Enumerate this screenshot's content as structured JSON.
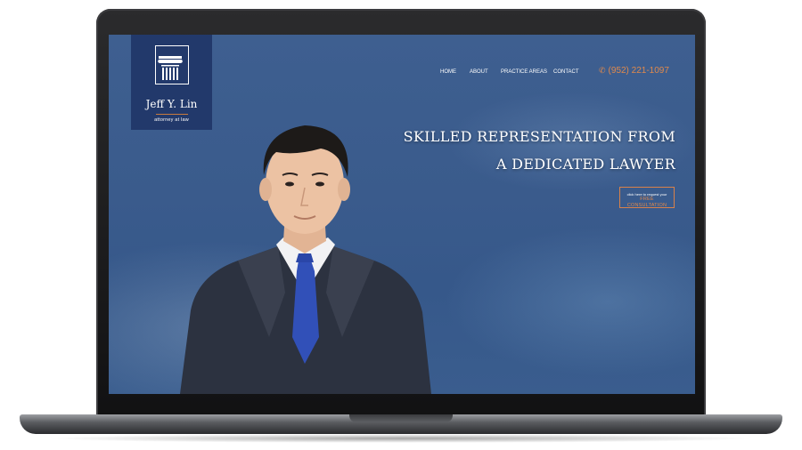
{
  "brand": {
    "name": "Jeff Y. Lin",
    "tagline": "attorney at law",
    "icon": "column-capital-icon"
  },
  "nav": {
    "items": [
      {
        "label": "HOME"
      },
      {
        "label": "ABOUT"
      },
      {
        "label": "PRACTICE AREAS"
      },
      {
        "label": "CONTACT"
      }
    ],
    "phone": "(952) 221-1097",
    "phone_icon": "phone-icon"
  },
  "hero": {
    "headline_line1": "SKILLED REPRESENTATION FROM",
    "headline_line2": "A DEDICATED LAWYER",
    "cta_small": "click here to request your",
    "cta_main": "FREE CONSULTATION"
  },
  "colors": {
    "accent": "#e0894c",
    "logo_bg": "#22396b",
    "hero_bg": "#3a5b8c"
  }
}
